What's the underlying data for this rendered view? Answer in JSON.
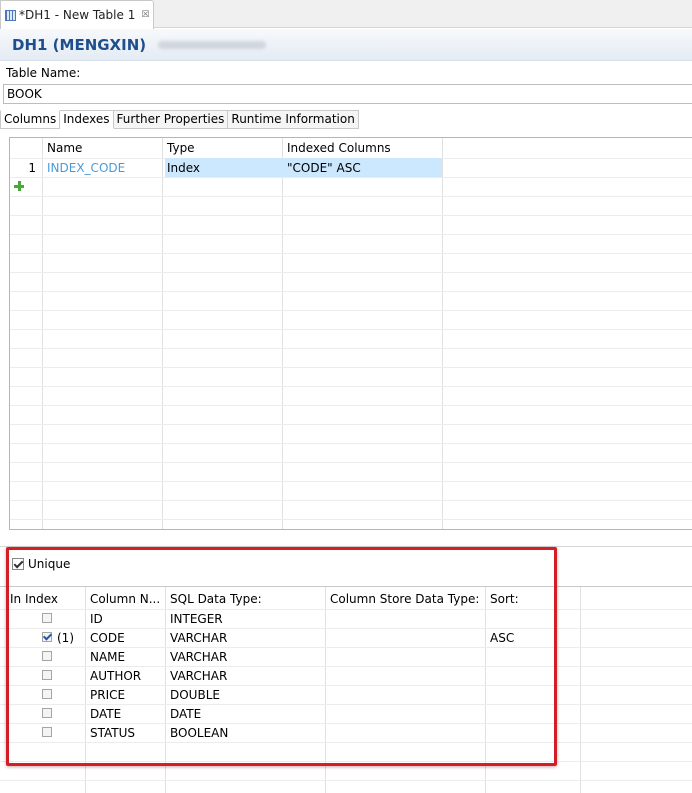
{
  "editor_tab": {
    "title": "*DH1 - New Table 1",
    "close_glyph": "☒"
  },
  "header": {
    "connection": "DH1 (MENGXIN)"
  },
  "table_name": {
    "label": "Table Name:",
    "value": "BOOK"
  },
  "subtabs": [
    {
      "label": "Columns"
    },
    {
      "label": "Indexes"
    },
    {
      "label": "Further Properties"
    },
    {
      "label": "Runtime Information"
    }
  ],
  "indexes": {
    "columns": [
      "Name",
      "Type",
      "Indexed Columns"
    ],
    "rows": [
      {
        "num": "1",
        "name": "INDEX_CODE",
        "type": "Index",
        "indexed": "\"CODE\" ASC"
      }
    ],
    "add_icon": "plus-icon"
  },
  "unique": {
    "label": "Unique",
    "checked": true
  },
  "index_columns": {
    "headers": [
      "In Index",
      "Column N...",
      "SQL Data Type:",
      "Column Store Data Type:",
      "Sort:"
    ],
    "rows": [
      {
        "checked": false,
        "order": "",
        "name": "ID",
        "type": "INTEGER",
        "store": "",
        "sort": ""
      },
      {
        "checked": true,
        "order": "(1)",
        "name": "CODE",
        "type": "VARCHAR",
        "store": "",
        "sort": "ASC"
      },
      {
        "checked": false,
        "order": "",
        "name": "NAME",
        "type": "VARCHAR",
        "store": "",
        "sort": ""
      },
      {
        "checked": false,
        "order": "",
        "name": "AUTHOR",
        "type": "VARCHAR",
        "store": "",
        "sort": ""
      },
      {
        "checked": false,
        "order": "",
        "name": "PRICE",
        "type": "DOUBLE",
        "store": "",
        "sort": ""
      },
      {
        "checked": false,
        "order": "",
        "name": "DATE",
        "type": "DATE",
        "store": "",
        "sort": ""
      },
      {
        "checked": false,
        "order": "",
        "name": "STATUS",
        "type": "BOOLEAN",
        "store": "",
        "sort": ""
      }
    ]
  },
  "colors": {
    "highlight": "#cce8ff",
    "link": "#4a9ad6",
    "title": "#1f4e8c",
    "annotation": "#d21f26"
  }
}
